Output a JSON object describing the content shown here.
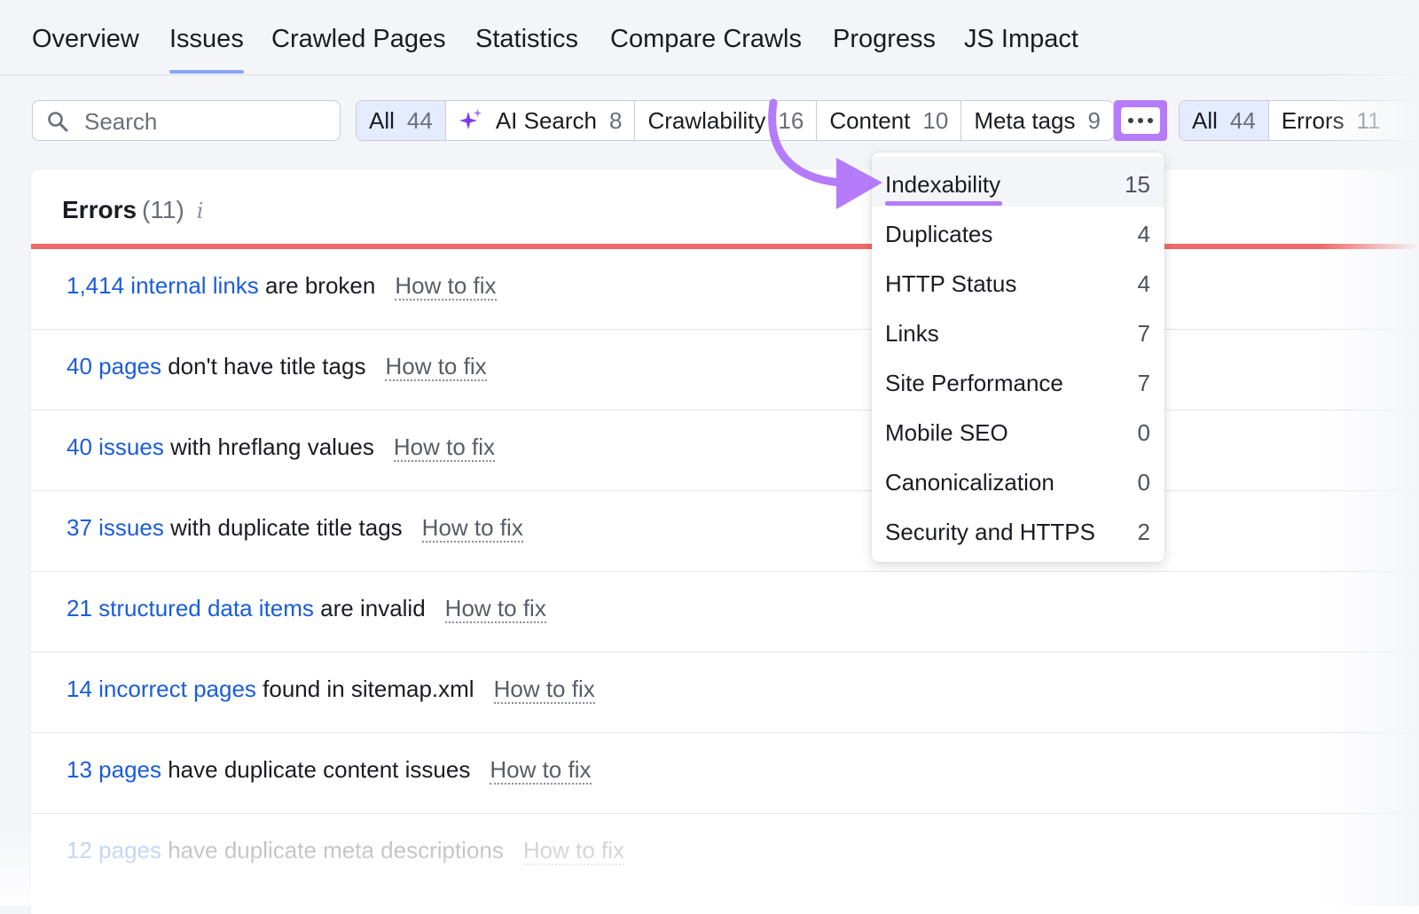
{
  "topnav": {
    "tabs": [
      "Overview",
      "Issues",
      "Crawled Pages",
      "Statistics",
      "Compare Crawls",
      "Progress",
      "JS Impact"
    ],
    "active": "Issues"
  },
  "search": {
    "placeholder": "Search"
  },
  "filters": {
    "categories": [
      {
        "label": "All",
        "count": "44"
      },
      {
        "label": "AI Search",
        "count": "8"
      },
      {
        "label": "Crawlability",
        "count": "16"
      },
      {
        "label": "Content",
        "count": "10"
      },
      {
        "label": "Meta tags",
        "count": "9"
      }
    ],
    "severity": [
      {
        "label": "All",
        "count": "44"
      },
      {
        "label": "Errors",
        "count": "11"
      }
    ]
  },
  "errors": {
    "title": "Errors",
    "count": "(11)",
    "info": "i",
    "accent": "#f16a6a",
    "rows": [
      {
        "link": "1,414 internal links",
        "text": "are broken",
        "fix": "How to fix"
      },
      {
        "link": "40 pages",
        "text": "don't have title tags",
        "fix": "How to fix"
      },
      {
        "link": "40 issues",
        "text": "with hreflang values",
        "fix": "How to fix"
      },
      {
        "link": "37 issues",
        "text": "with duplicate title tags",
        "fix": "How to fix"
      },
      {
        "link": "21 structured data items",
        "text": "are invalid",
        "fix": "How to fix"
      },
      {
        "link": "14 incorrect pages",
        "text": "found in sitemap.xml",
        "fix": "How to fix"
      },
      {
        "link": "13 pages",
        "text": "have duplicate content issues",
        "fix": "How to fix"
      },
      {
        "link": "12 pages",
        "text": "have duplicate meta descriptions",
        "fix": "How to fix"
      }
    ]
  },
  "dropdown": {
    "items": [
      {
        "label": "Indexability",
        "count": "15"
      },
      {
        "label": "Duplicates",
        "count": "4"
      },
      {
        "label": "HTTP Status",
        "count": "4"
      },
      {
        "label": "Links",
        "count": "7"
      },
      {
        "label": "Site Performance",
        "count": "7"
      },
      {
        "label": "Mobile SEO",
        "count": "0"
      },
      {
        "label": "Canonicalization",
        "count": "0"
      },
      {
        "label": "Security and HTTPS",
        "count": "2"
      }
    ],
    "highlight_color": "#b47cfb"
  },
  "icons": {
    "search": "search-icon",
    "ai": "sparkle-icon",
    "more": "more-dots-icon",
    "info": "info-icon",
    "annotation": "curved-arrow-icon"
  },
  "colors": {
    "link": "#1a5ddb",
    "active_tab_underline": "#8aa4f2",
    "annotation_purple": "#b47cfb"
  }
}
